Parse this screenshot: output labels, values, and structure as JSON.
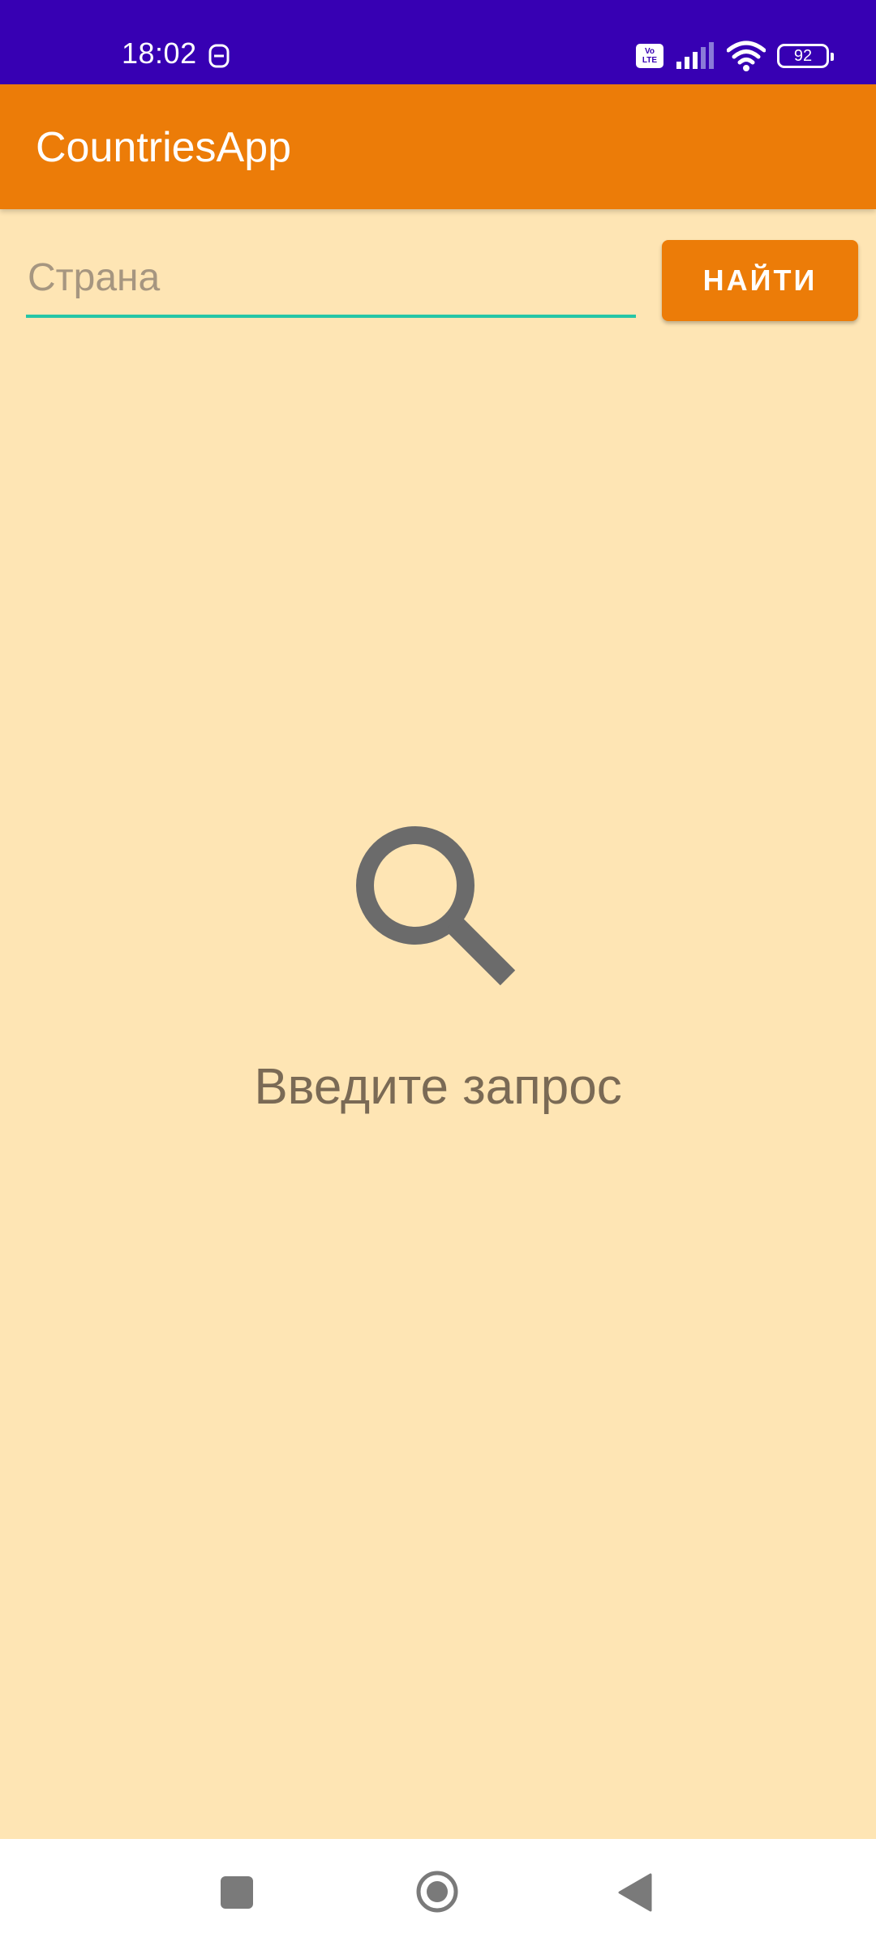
{
  "status_bar": {
    "time": "18:02",
    "volte_top": "Vo",
    "volte_bottom": "LTE",
    "battery_level": "92"
  },
  "app_bar": {
    "title": "CountriesApp"
  },
  "search": {
    "placeholder": "Страна",
    "value": "",
    "button_label": "НАЙТИ"
  },
  "empty_state": {
    "icon": "search-icon",
    "message": "Введите запрос"
  },
  "navigation": {
    "recents_icon": "square-icon",
    "home_icon": "circle-home-icon",
    "back_icon": "triangle-back-icon"
  },
  "colors": {
    "status_bar": "#3700B3",
    "app_bar": "#EC7C08",
    "background": "#FEE5B4",
    "input_underline": "#26C6A6",
    "button": "#EC7C08",
    "empty_icon": "#6B6B6B",
    "empty_text": "#7A6A55"
  }
}
